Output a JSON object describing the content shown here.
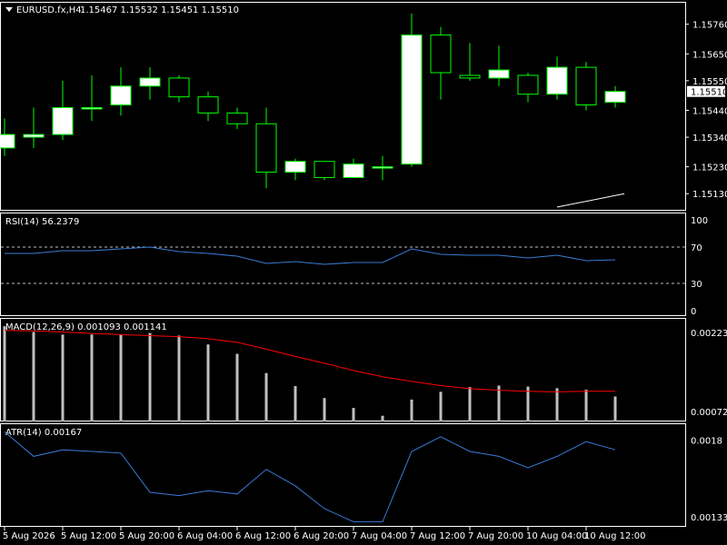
{
  "header": {
    "symbol": "EURUSD.fx,H4",
    "ohlc": "1.15467 1.15532 1.15451 1.15510"
  },
  "colors": {
    "background": "#000000",
    "grid_border": "#ffffff",
    "bull_candle_fill": "#ffffff",
    "candle_outline": "#00ff00",
    "rsi_line": "#3a7bd5",
    "macd_hist": "#c0c0c0",
    "macd_signal": "#ff0000",
    "atr_line": "#3a7bd5",
    "level_dash": "#c0c0c0",
    "current_price_label_bg": "#ffffff",
    "current_price_label_fg": "#000000"
  },
  "chart_data": [
    {
      "type": "candlestick",
      "pane": "main",
      "ylim": [
        1.1508,
        1.1583
      ],
      "y_ticks": [
        "1.15760",
        "1.15650",
        "1.15550",
        "1.15440",
        "1.15340",
        "1.15230",
        "1.15130"
      ],
      "y_tick_values": [
        1.1576,
        1.1565,
        1.1555,
        1.1544,
        1.1534,
        1.1523,
        1.1513
      ],
      "current_price": "1.15510",
      "current_price_value": 1.1551,
      "candles": [
        {
          "o": 1.153,
          "h": 1.1541,
          "l": 1.1527,
          "c": 1.1535
        },
        {
          "o": 1.1534,
          "h": 1.1545,
          "l": 1.153,
          "c": 1.1535
        },
        {
          "o": 1.1535,
          "h": 1.1555,
          "l": 1.1533,
          "c": 1.1545
        },
        {
          "o": 1.1545,
          "h": 1.1557,
          "l": 1.154,
          "c": 1.1545
        },
        {
          "o": 1.1546,
          "h": 1.156,
          "l": 1.1542,
          "c": 1.1553
        },
        {
          "o": 1.1553,
          "h": 1.156,
          "l": 1.1548,
          "c": 1.1556
        },
        {
          "o": 1.1556,
          "h": 1.1557,
          "l": 1.1547,
          "c": 1.1549
        },
        {
          "o": 1.1549,
          "h": 1.1551,
          "l": 1.154,
          "c": 1.1543
        },
        {
          "o": 1.1543,
          "h": 1.1545,
          "l": 1.1537,
          "c": 1.1539
        },
        {
          "o": 1.1539,
          "h": 1.1545,
          "l": 1.1515,
          "c": 1.1521
        },
        {
          "o": 1.1521,
          "h": 1.1526,
          "l": 1.1518,
          "c": 1.1525
        },
        {
          "o": 1.1525,
          "h": 1.1525,
          "l": 1.1518,
          "c": 1.1519
        },
        {
          "o": 1.1519,
          "h": 1.1526,
          "l": 1.1519,
          "c": 1.1524
        },
        {
          "o": 1.1523,
          "h": 1.1527,
          "l": 1.1518,
          "c": 1.1523
        },
        {
          "o": 1.1524,
          "h": 1.158,
          "l": 1.1523,
          "c": 1.1572
        },
        {
          "o": 1.1572,
          "h": 1.1575,
          "l": 1.1548,
          "c": 1.1558
        },
        {
          "o": 1.1557,
          "h": 1.1569,
          "l": 1.1555,
          "c": 1.1556
        },
        {
          "o": 1.1556,
          "h": 1.1568,
          "l": 1.1553,
          "c": 1.1559
        },
        {
          "o": 1.1557,
          "h": 1.1558,
          "l": 1.1547,
          "c": 1.155
        },
        {
          "o": 1.155,
          "h": 1.1564,
          "l": 1.1548,
          "c": 1.156
        },
        {
          "o": 1.156,
          "h": 1.1562,
          "l": 1.1544,
          "c": 1.1546
        },
        {
          "o": 1.1547,
          "h": 1.1553,
          "l": 1.1545,
          "c": 1.1551
        }
      ],
      "trendline": {
        "from": [
          19,
          1.1508
        ],
        "to": [
          21,
          1.1513
        ]
      }
    },
    {
      "type": "line",
      "pane": "rsi",
      "title": "RSI(14) 56.2379",
      "ylim": [
        0,
        100
      ],
      "y_ticks": [
        "100",
        "70",
        "30",
        "0"
      ],
      "y_tick_values": [
        100,
        70,
        30,
        0
      ],
      "levels": [
        70,
        30
      ],
      "values": [
        63,
        63,
        66,
        66,
        68,
        70,
        65,
        63,
        60,
        52,
        54,
        51,
        53,
        53,
        68,
        62,
        61,
        61,
        58,
        61,
        55,
        56
      ]
    },
    {
      "type": "bar+line",
      "pane": "macd",
      "title": "MACD(12,26,9) 0.001093 0.001141",
      "ylim": [
        0.00053,
        0.00238
      ],
      "y_ticks": [
        "0.002238",
        "0.000723"
      ],
      "y_tick_values": [
        0.002238,
        0.000723
      ],
      "histogram": [
        0.00236,
        0.00225,
        0.0022,
        0.0022,
        0.0022,
        0.00223,
        0.00218,
        0.00201,
        0.00183,
        0.00146,
        0.00121,
        0.00098,
        0.00079,
        0.00064,
        0.00095,
        0.0011,
        0.00119,
        0.00122,
        0.0012,
        0.00117,
        0.00114,
        0.00101
      ],
      "signal": [
        0.00228,
        0.00227,
        0.00225,
        0.00222,
        0.0022,
        0.00218,
        0.00216,
        0.00212,
        0.00205,
        0.00192,
        0.00178,
        0.00165,
        0.00151,
        0.00139,
        0.0013,
        0.00122,
        0.00116,
        0.00113,
        0.00111,
        0.0011,
        0.00111,
        0.00111
      ]
    },
    {
      "type": "line",
      "pane": "atr",
      "title": "ATR(14) 0.00167",
      "ylim": [
        0.00128,
        0.00188
      ],
      "y_ticks": [
        "0.0018",
        "0.00133"
      ],
      "y_tick_values": [
        0.0018,
        0.00133
      ],
      "values": [
        0.00185,
        0.0017,
        0.00174,
        0.00173,
        0.00172,
        0.00148,
        0.00146,
        0.00149,
        0.00147,
        0.00162,
        0.00152,
        0.00138,
        0.0013,
        0.0013,
        0.00173,
        0.00182,
        0.00173,
        0.0017,
        0.00163,
        0.0017,
        0.00179,
        0.00174
      ]
    }
  ],
  "x_axis": {
    "labels": [
      "5 Aug 2026",
      "5 Aug 12:00",
      "5 Aug 20:00",
      "6 Aug 04:00",
      "6 Aug 12:00",
      "6 Aug 20:00",
      "7 Aug 04:00",
      "7 Aug 12:00",
      "7 Aug 20:00",
      "10 Aug 04:00",
      "10 Aug 12:00"
    ],
    "label_bar_index": [
      0,
      2,
      4,
      6,
      8,
      10,
      12,
      14,
      16,
      18,
      20
    ]
  }
}
